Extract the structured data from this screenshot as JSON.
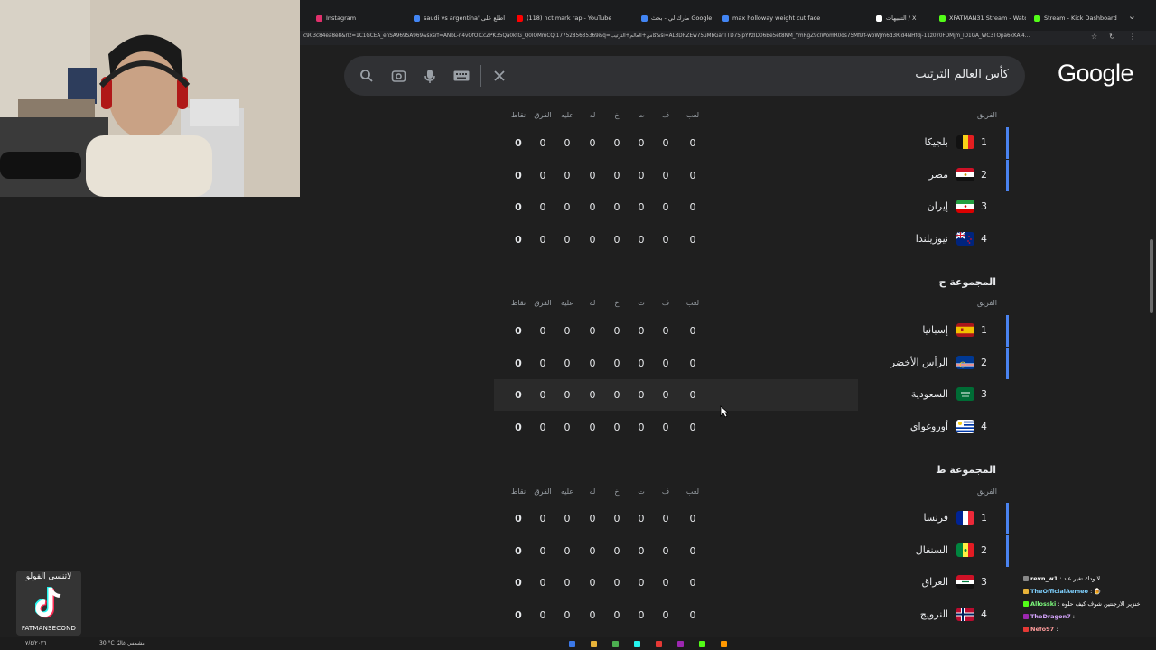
{
  "browser": {
    "tabs": [
      {
        "label": "Instagram",
        "color": "#e1306c"
      },
      {
        "label": "saudi vs argentina' اطلع على",
        "color": "#4285f4"
      },
      {
        "label": "(118) nct mark rap - YouTube",
        "color": "#ff0000"
      },
      {
        "label": "مارك لي - بحث Google",
        "color": "#4285f4"
      },
      {
        "label": "max holloway weight cut face",
        "color": "#4285f4"
      },
      {
        "label": "التنبيهات / X",
        "color": "#ffffff"
      },
      {
        "label": "XFATMAN31 Stream - Watch",
        "color": "#53fc18"
      },
      {
        "label": "Stream - Kick Dashboard",
        "color": "#53fc18"
      }
    ],
    "url": "c903c84ea8e8&rlz=1C1GCEA_enSA969SA969&sxsrf=ANbL-n4vQfOICcZPK35Qa0ktG_Q0lOMmCQ:1775285635369&q=كأس+العالم+الترتيب&si=AL3DRZEw75uMbGarTTD75jpYPzID06Be5et8NM_YmRgZ9clWomR0ds75MfDf-wbWJm6d3Rid4NHfdj-11z0Y0FDMjm_lD1GA_WC3TOpa6kKAI4..."
  },
  "google": {
    "logo": "Google",
    "query": "كأس العالم الترتيب"
  },
  "table_headers": {
    "team": "الفريق",
    "played": "لعب",
    "won": "ف",
    "drawn": "ت",
    "lost": "خ",
    "gf": "له",
    "ga": "عليه",
    "gd": "الفرق",
    "pts": "نقاط"
  },
  "groups": [
    {
      "title": "",
      "teams": [
        {
          "pos": "1",
          "name": "بلجيكا",
          "flag": "belgium",
          "stats": [
            "0",
            "0",
            "0",
            "0",
            "0",
            "0",
            "0",
            "0"
          ]
        },
        {
          "pos": "2",
          "name": "مصر",
          "flag": "egypt",
          "stats": [
            "0",
            "0",
            "0",
            "0",
            "0",
            "0",
            "0",
            "0"
          ]
        },
        {
          "pos": "3",
          "name": "إيران",
          "flag": "iran",
          "stats": [
            "0",
            "0",
            "0",
            "0",
            "0",
            "0",
            "0",
            "0"
          ]
        },
        {
          "pos": "4",
          "name": "نيوزيلندا",
          "flag": "new-zealand",
          "stats": [
            "0",
            "0",
            "0",
            "0",
            "0",
            "0",
            "0",
            "0"
          ]
        }
      ]
    },
    {
      "title": "المجموعة ح",
      "teams": [
        {
          "pos": "1",
          "name": "إسبانيا",
          "flag": "spain",
          "stats": [
            "0",
            "0",
            "0",
            "0",
            "0",
            "0",
            "0",
            "0"
          ]
        },
        {
          "pos": "2",
          "name": "الرأس الأخضر",
          "flag": "cape-verde",
          "stats": [
            "0",
            "0",
            "0",
            "0",
            "0",
            "0",
            "0",
            "0"
          ]
        },
        {
          "pos": "3",
          "name": "السعودية",
          "flag": "saudi-arabia",
          "stats": [
            "0",
            "0",
            "0",
            "0",
            "0",
            "0",
            "0",
            "0"
          ]
        },
        {
          "pos": "4",
          "name": "أوروغواي",
          "flag": "uruguay",
          "stats": [
            "0",
            "0",
            "0",
            "0",
            "0",
            "0",
            "0",
            "0"
          ]
        }
      ]
    },
    {
      "title": "المجموعة ط",
      "teams": [
        {
          "pos": "1",
          "name": "فرنسا",
          "flag": "france",
          "stats": [
            "0",
            "0",
            "0",
            "0",
            "0",
            "0",
            "0",
            "0"
          ]
        },
        {
          "pos": "2",
          "name": "السنغال",
          "flag": "senegal",
          "stats": [
            "0",
            "0",
            "0",
            "0",
            "0",
            "0",
            "0",
            "0"
          ]
        },
        {
          "pos": "3",
          "name": "العراق",
          "flag": "iraq",
          "stats": [
            "0",
            "0",
            "0",
            "0",
            "0",
            "0",
            "0",
            "0"
          ]
        },
        {
          "pos": "4",
          "name": "النرويج",
          "flag": "norway",
          "stats": [
            "0",
            "0",
            "0",
            "0",
            "0",
            "0",
            "0",
            "0"
          ]
        }
      ]
    }
  ],
  "overlay": {
    "tiktok_top": "لاتنسى الفولو",
    "tiktok_handle": "FATMANSECOND",
    "chat": [
      {
        "user": "revn_w1",
        "color": "#ffffff",
        "msg": "لا ودك تغير عاد"
      },
      {
        "user": "TheOfficialAemeo",
        "color": "#7fd1ff",
        "msg": "🍺"
      },
      {
        "user": "Allosski",
        "color": "#7cf97c",
        "msg": "خنزير الارجنتين شوف كيف حلوه"
      },
      {
        "user": "TheDragon7",
        "color": "#d7a6ff",
        "msg": ""
      },
      {
        "user": "Nefo97",
        "color": "#ff9c9c",
        "msg": ""
      }
    ],
    "taskbar_date": "٧/٤/٢٠٢٦",
    "taskbar_weather": "30 °C مشمس غالبًا"
  },
  "colors": {
    "qualifier_bar": "#4a83f0",
    "background": "#1f1f1f",
    "search_bg": "#303134"
  }
}
